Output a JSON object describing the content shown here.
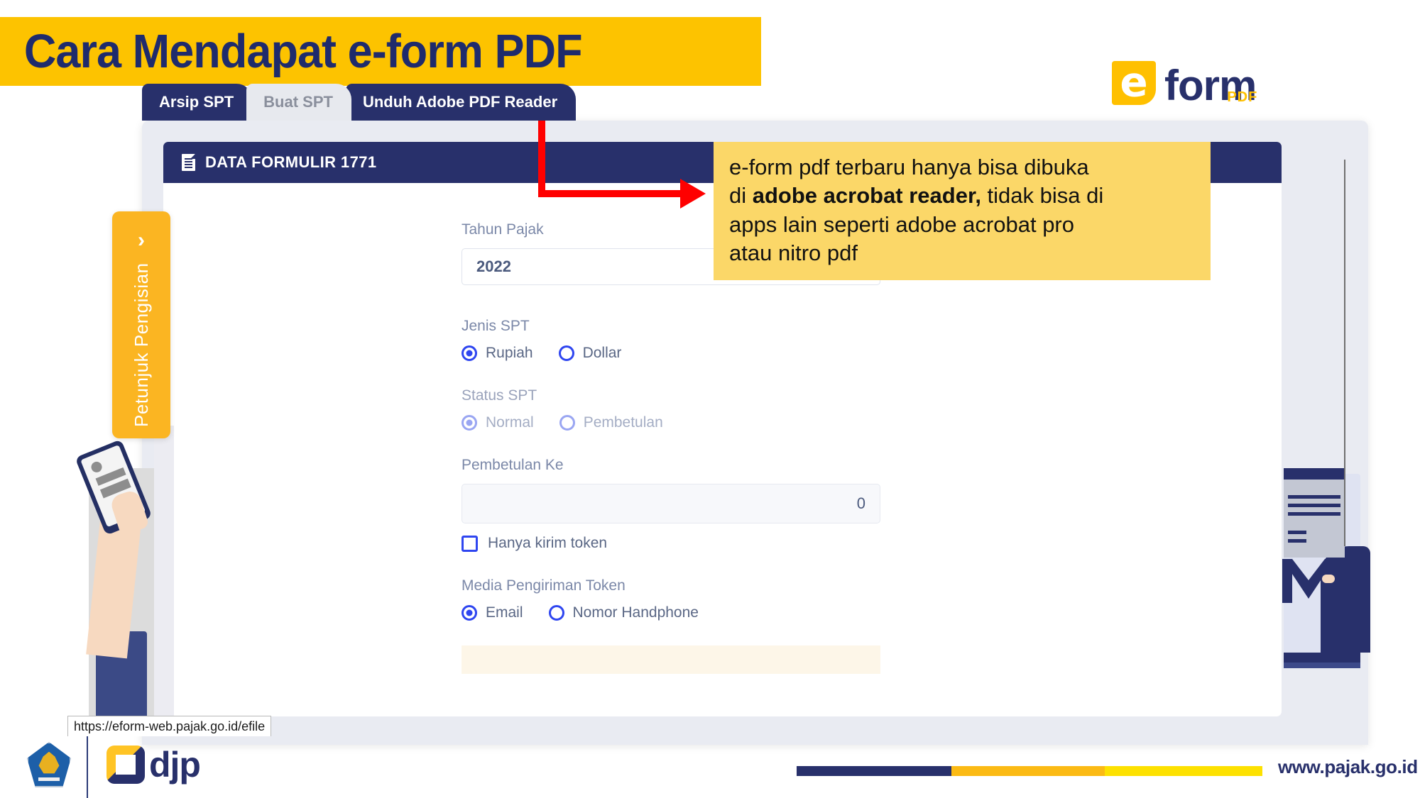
{
  "slide": {
    "title": "Cara Mendapat e-form PDF"
  },
  "brand_logo": {
    "mark_letter": "e",
    "word": "form",
    "sub": "PDF"
  },
  "tabs": [
    {
      "label": "Arsip SPT",
      "state": "navy"
    },
    {
      "label": "Buat SPT",
      "state": "light"
    },
    {
      "label": "Unduh Adobe PDF Reader",
      "state": "navy"
    }
  ],
  "card": {
    "header_title": "DATA FORMULIR 1771",
    "header_icon": "document-icon"
  },
  "form": {
    "tahun_pajak": {
      "label": "Tahun Pajak",
      "value": "2022",
      "clear_icon": "close-icon",
      "chevron_icon": "chevron-down-icon"
    },
    "jenis_spt": {
      "label": "Jenis SPT",
      "options": [
        {
          "label": "Rupiah",
          "selected": true
        },
        {
          "label": "Dollar",
          "selected": false
        }
      ]
    },
    "status_spt": {
      "label": "Status SPT",
      "options": [
        {
          "label": "Normal",
          "selected": true
        },
        {
          "label": "Pembetulan",
          "selected": false
        }
      ]
    },
    "pembetulan_ke": {
      "label": "Pembetulan Ke",
      "value": "0"
    },
    "hanya_kirim_token": {
      "label": "Hanya kirim token",
      "checked": false
    },
    "media_pengiriman_token": {
      "label": "Media Pengiriman Token",
      "options": [
        {
          "label": "Email",
          "selected": true
        },
        {
          "label": "Nomor Handphone",
          "selected": false
        }
      ]
    }
  },
  "side_tab": {
    "label": "Petunjuk Pengisian",
    "chevron": "›"
  },
  "callout": {
    "line1": "e-form pdf terbaru hanya bisa dibuka",
    "line2_pre": "di ",
    "line2_bold": "adobe acrobat reader,",
    "line2_post": " tidak bisa di",
    "line3": "apps lain seperti adobe acrobat pro",
    "line4": "atau nitro pdf"
  },
  "status_bar": {
    "url": "https://eform-web.pajak.go.id/efile"
  },
  "footer": {
    "djp_word": "djp",
    "website": "www.pajak.go.id"
  },
  "colors": {
    "navy": "#28306B",
    "gold": "#FDC300",
    "callout_yellow": "#FBD768",
    "side_tab_orange": "#FBB522",
    "arrow_red": "#FF0000",
    "radio_blue": "#2F46F0",
    "cream": "#FDF6E8"
  }
}
